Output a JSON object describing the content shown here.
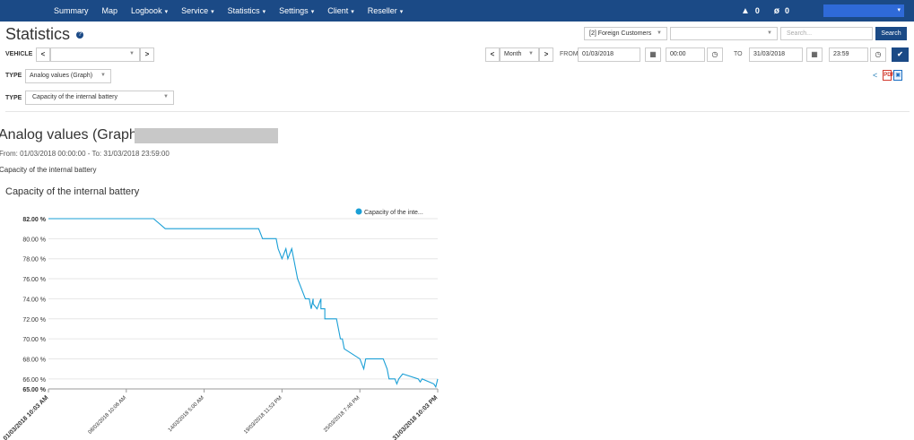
{
  "navbar": {
    "menu": [
      {
        "label": "Summary",
        "dropdown": false
      },
      {
        "label": "Map",
        "dropdown": false
      },
      {
        "label": "Logbook",
        "dropdown": true
      },
      {
        "label": "Service",
        "dropdown": true
      },
      {
        "label": "Statistics",
        "dropdown": true
      },
      {
        "label": "Settings",
        "dropdown": true
      },
      {
        "label": "Client",
        "dropdown": true
      },
      {
        "label": "Reseller",
        "dropdown": true
      }
    ],
    "alerts_count": "0",
    "hidden_count": "0",
    "caret": "▾"
  },
  "page": {
    "title": "Statistics",
    "help": "?"
  },
  "filters": {
    "customer_select": "[2] Foreign Customers",
    "search_placeholder": "Search...",
    "search_button": "Search",
    "vehicle_label": "VEHICLE",
    "type_label": "TYPE",
    "type_value": "Analog values (Graph)",
    "type2_label": "TYPE",
    "type2_value": "Capacity of the internal battery",
    "period_value": "Month",
    "from_label": "FROM",
    "from_date": "01/03/2018",
    "from_time": "00:00",
    "to_label": "TO",
    "to_date": "31/03/2018",
    "to_time": "23:59"
  },
  "report": {
    "title": "Analog values (Graph),",
    "range": "From: 01/03/2018 00:00:00 - To: 31/03/2018 23:59:00",
    "measure": "Capacity of the internal battery"
  },
  "colors": {
    "navbar": "#1b4a86",
    "series": "#1a9fd6",
    "accent": "#1b4a86"
  },
  "chart_data": {
    "type": "line",
    "title": "Capacity of the internal battery",
    "ylim": [
      65,
      82
    ],
    "y_ticks": [
      "82.00 %",
      "80.00 %",
      "78.00 %",
      "76.00 %",
      "74.00 %",
      "72.00 %",
      "70.00 %",
      "68.00 %",
      "66.00 %",
      "65.00 %"
    ],
    "y_tick_values": [
      82,
      80,
      78,
      76,
      74,
      72,
      70,
      68,
      66,
      65
    ],
    "x_ticks": [
      "01/03/2018 10:03 AM",
      "08/03/2018 10:06 AM",
      "14/03/2018 5:00 AM",
      "19/03/2018 11:53 PM",
      "25/03/2018 7:46 PM",
      "31/03/2018 10:03 PM"
    ],
    "grid": true,
    "legend": "top-right",
    "series": [
      {
        "name": "Capacity of the inte...",
        "x": [
          0,
          0.27,
          0.3,
          0.54,
          0.55,
          0.585,
          0.59,
          0.6,
          0.61,
          0.615,
          0.62,
          0.625,
          0.63,
          0.635,
          0.64,
          0.65,
          0.655,
          0.66,
          0.67,
          0.675,
          0.68,
          0.68,
          0.69,
          0.69,
          0.7,
          0.7,
          0.71,
          0.71,
          0.72,
          0.74,
          0.745,
          0.75,
          0.755,
          0.76,
          0.8,
          0.81,
          0.815,
          0.82,
          0.86,
          0.87,
          0.875,
          0.88,
          0.89,
          0.895,
          0.9,
          0.91,
          0.95,
          0.955,
          0.96,
          0.99,
          0.995,
          1.0
        ],
        "y": [
          82,
          82,
          81,
          81,
          80,
          80,
          79,
          78,
          79,
          78,
          78.5,
          79,
          78,
          77,
          76,
          75,
          74.5,
          74,
          74,
          73,
          74,
          73.5,
          73,
          73,
          74,
          73,
          73,
          72,
          72,
          72,
          71,
          70,
          70,
          69,
          68,
          67,
          68,
          68,
          68,
          67,
          66,
          66,
          66,
          65.5,
          66,
          66.5,
          66,
          65.7,
          66,
          65.5,
          65.2,
          66
        ]
      }
    ]
  }
}
